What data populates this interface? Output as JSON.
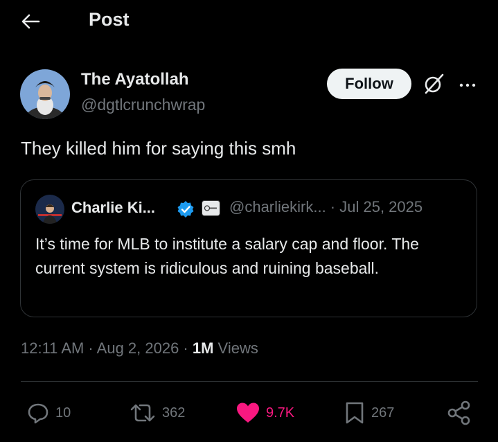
{
  "header": {
    "title": "Post",
    "back_icon": "arrow-left-icon"
  },
  "post": {
    "author_name": "The Ayatollah",
    "author_handle": "@dgtlcrunchwrap",
    "follow_label": "Follow",
    "text": "They killed him for saying this smh",
    "timestamp": "12:11 AM · Aug 2, 2026 · ",
    "views_count": "1M",
    "views_label": " Views"
  },
  "quote": {
    "author_name": "Charlie Ki...",
    "handle_date": "@charliekirk... · Jul 25, 2025",
    "text": "It’s time for MLB to institute a salary cap and floor. The current system is ridiculous and ruining baseball."
  },
  "actions": {
    "replies": "10",
    "reposts": "362",
    "likes": "9.7K",
    "bookmarks": "267"
  },
  "colors": {
    "background": "#000000",
    "text": "#e7e9ea",
    "muted": "#71767b",
    "like": "#f91880",
    "verified": "#1d9bf0"
  }
}
